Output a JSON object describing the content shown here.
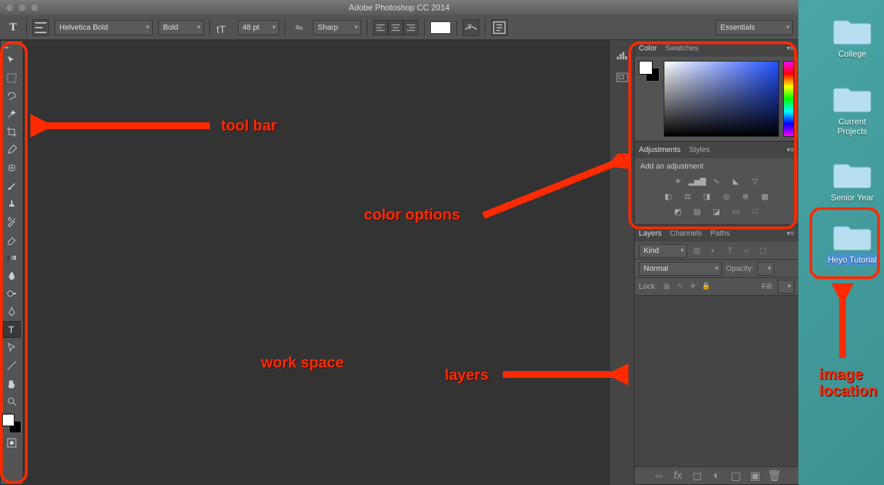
{
  "window": {
    "title": "Adobe Photoshop CC 2014"
  },
  "options_bar": {
    "font": "Helvetica Bold",
    "weight": "Bold",
    "size": "48 pt",
    "antialias": "Sharp",
    "workspace": "Essentials"
  },
  "panels": {
    "color": {
      "tabs": [
        "Color",
        "Swatches"
      ]
    },
    "adjustments": {
      "tabs": [
        "Adjustments",
        "Styles"
      ],
      "title": "Add an adjustment"
    },
    "layers": {
      "tabs": [
        "Layers",
        "Channels",
        "Paths"
      ],
      "kind": "Kind",
      "blend": "Normal",
      "opacity_label": "Opacity:",
      "lock_label": "Lock:",
      "fill_label": "Fill:"
    }
  },
  "desktop": {
    "folders": [
      {
        "label": "College"
      },
      {
        "label": "Current Projects"
      },
      {
        "label": "Senior Year"
      },
      {
        "label": "Heyo Tutorial"
      }
    ]
  },
  "annotations": {
    "toolbar": "tool bar",
    "workspace": "work space",
    "color_options": "color options",
    "layers": "layers",
    "image_location": "image location"
  }
}
